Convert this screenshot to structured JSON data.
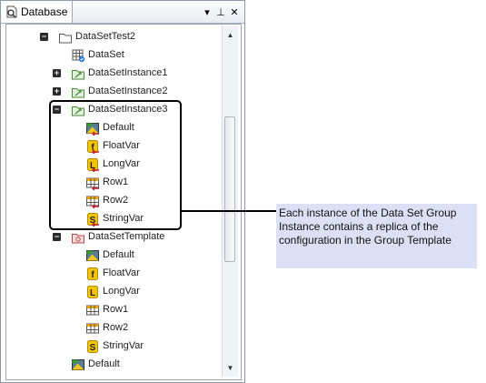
{
  "panel": {
    "tab_label": "Database",
    "buttons": {
      "dropdown": "▾",
      "pin": "⊥",
      "close": "✕"
    }
  },
  "tree": [
    {
      "label": "DataSetTest2",
      "icon": "folder-icon",
      "expander": "−"
    },
    {
      "label": "DataSet",
      "icon": "dataset-icon"
    },
    {
      "label": "DataSetInstance1",
      "icon": "instance-icon",
      "expander": "+"
    },
    {
      "label": "DataSetInstance2",
      "icon": "instance-icon",
      "expander": "+"
    },
    {
      "label": "DataSetInstance3",
      "icon": "instance-icon",
      "expander": "−"
    },
    {
      "label": "Default",
      "icon": "default-icon",
      "linked": true
    },
    {
      "label": "FloatVar",
      "icon": "float-var-icon",
      "linked": true
    },
    {
      "label": "LongVar",
      "icon": "long-var-icon",
      "linked": true
    },
    {
      "label": "Row1",
      "icon": "row-icon",
      "linked": true
    },
    {
      "label": "Row2",
      "icon": "row-icon",
      "linked": true
    },
    {
      "label": "StringVar",
      "icon": "string-var-icon",
      "linked": true
    },
    {
      "label": "DataSetTemplate",
      "icon": "template-icon",
      "expander": "−"
    },
    {
      "label": "Default",
      "icon": "default-icon"
    },
    {
      "label": "FloatVar",
      "icon": "float-var-icon"
    },
    {
      "label": "LongVar",
      "icon": "long-var-icon"
    },
    {
      "label": "Row1",
      "icon": "row-icon"
    },
    {
      "label": "Row2",
      "icon": "row-icon"
    },
    {
      "label": "StringVar",
      "icon": "string-var-icon"
    },
    {
      "label": "Default",
      "icon": "default-icon"
    }
  ],
  "icon_glyphs": {
    "float": "f",
    "long": "L",
    "string": "S"
  },
  "callout": {
    "text": "Each instance of the Data Set Group Instance contains a replica of the configuration in the Group Template"
  },
  "colors": {
    "callout_bg": "#dde0f4",
    "var_icon": "#f5c400",
    "link_arrow": "#c0182c"
  }
}
